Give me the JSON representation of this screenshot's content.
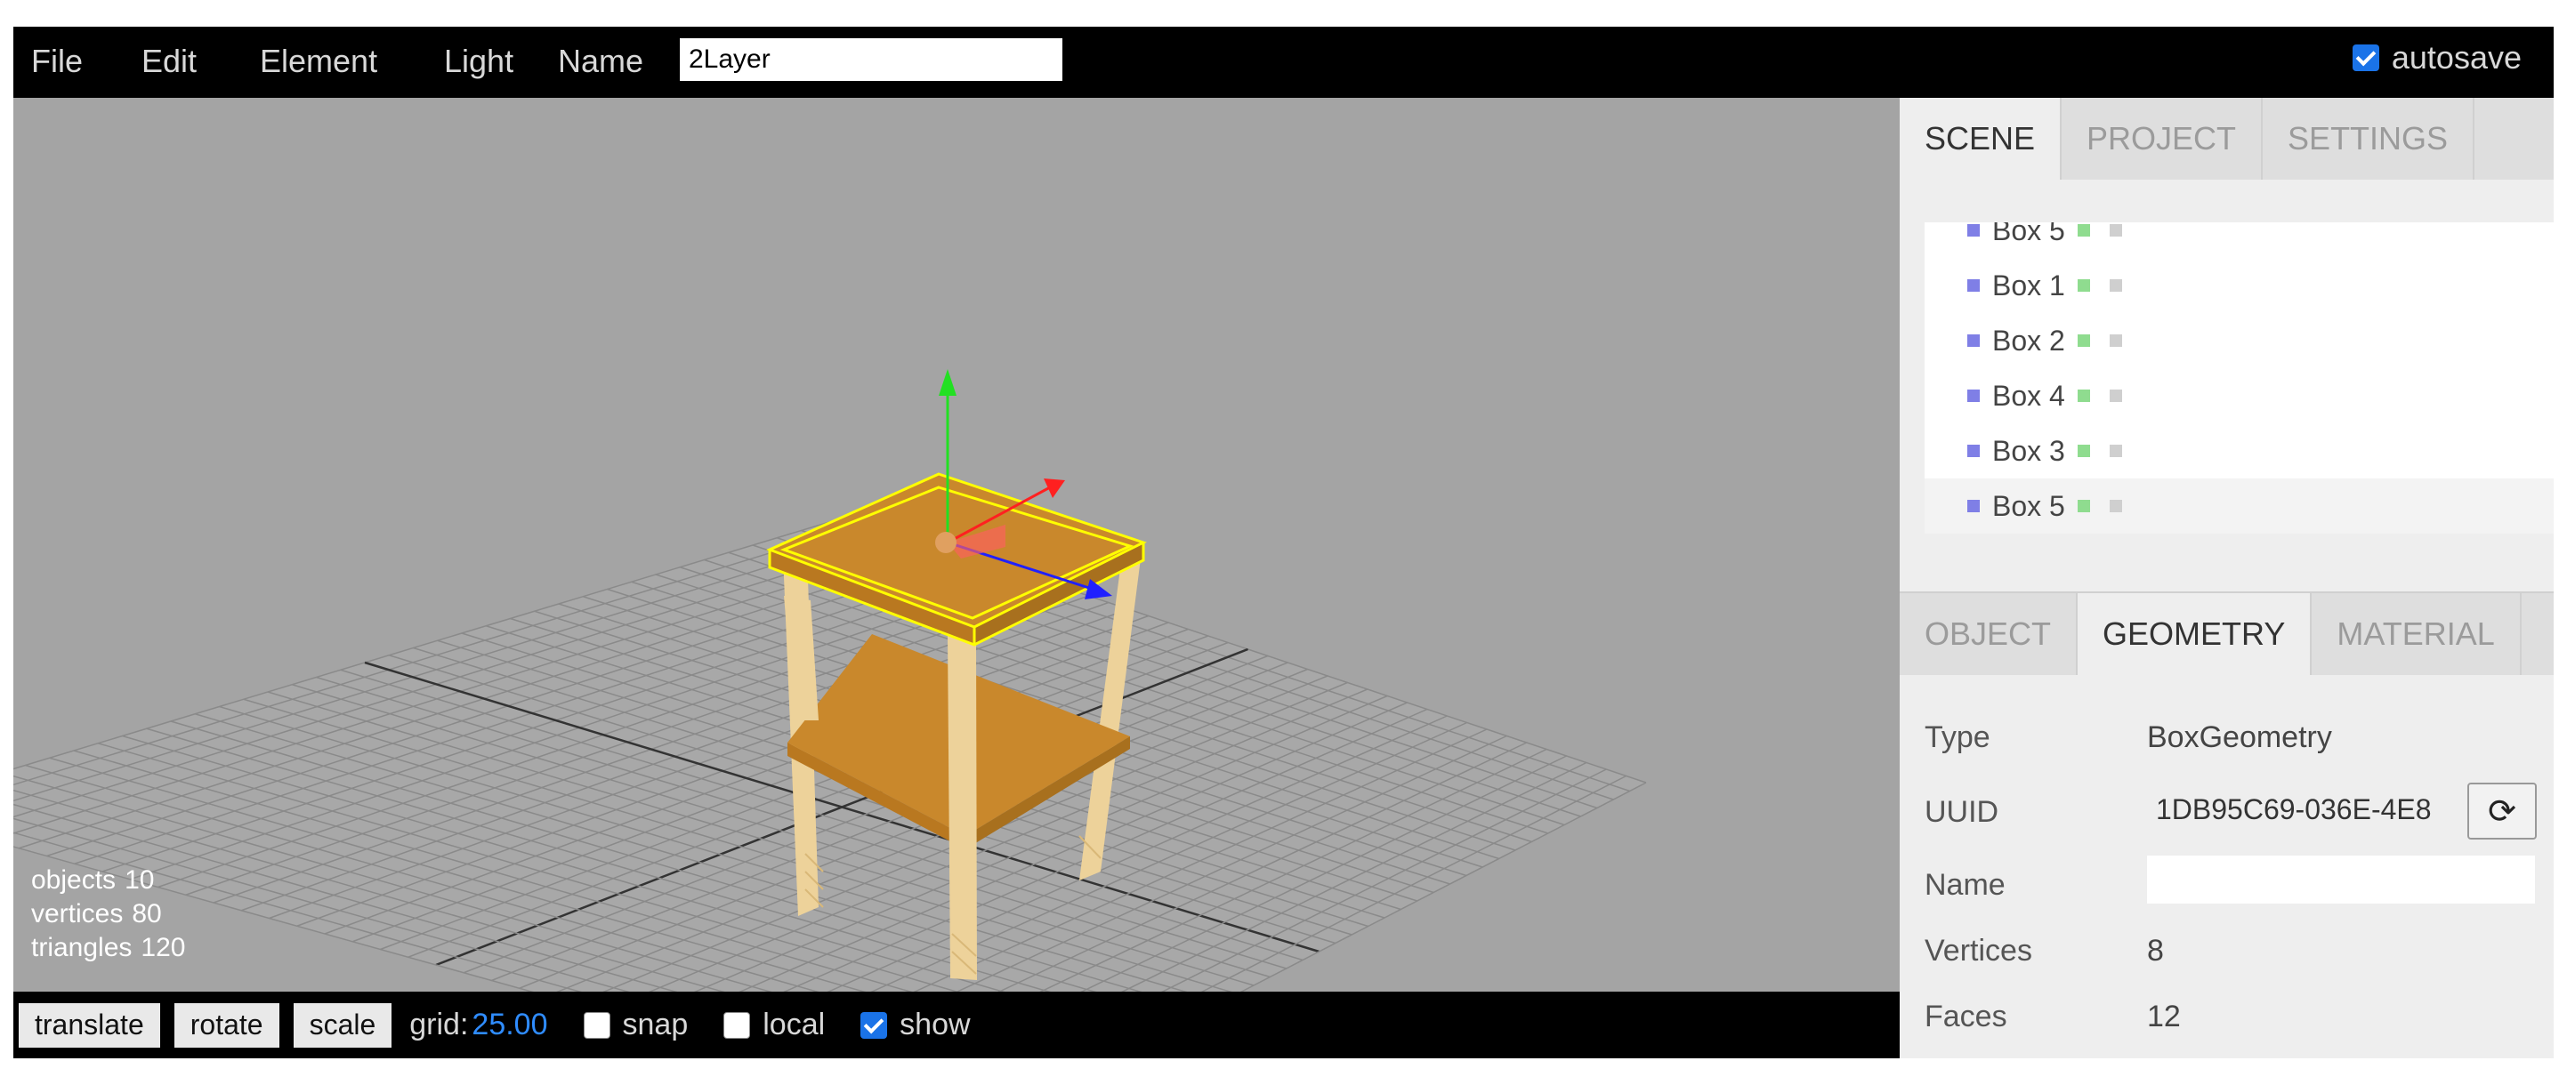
{
  "menu": {
    "items": [
      "File",
      "Edit",
      "Element",
      "Light"
    ],
    "name_label": "Name",
    "name_value": "2Layer",
    "autosave_label": "autosave",
    "autosave_checked": true
  },
  "viewport": {
    "info": {
      "objects_label": "objects",
      "objects_value": "10",
      "vertices_label": "vertices",
      "vertices_value": "80",
      "triangles_label": "triangles",
      "triangles_value": "120"
    }
  },
  "toolbar": {
    "translate_label": "translate",
    "rotate_label": "rotate",
    "scale_label": "scale",
    "grid_label": "grid:",
    "grid_value": "25.00",
    "snap_label": "snap",
    "snap_checked": false,
    "local_label": "local",
    "local_checked": false,
    "show_label": "show",
    "show_checked": true
  },
  "sidebar": {
    "top_tabs": [
      "SCENE",
      "PROJECT",
      "SETTINGS"
    ],
    "top_active": "SCENE",
    "outliner": [
      {
        "label": "Box 5",
        "selected": false
      },
      {
        "label": "Box 1",
        "selected": false
      },
      {
        "label": "Box 2",
        "selected": false
      },
      {
        "label": "Box 4",
        "selected": false
      },
      {
        "label": "Box 3",
        "selected": false
      },
      {
        "label": "Box 5",
        "selected": true
      }
    ],
    "bottom_tabs": [
      "OBJECT",
      "GEOMETRY",
      "MATERIAL"
    ],
    "bottom_active": "GEOMETRY",
    "geometry": {
      "type_label": "Type",
      "type_value": "BoxGeometry",
      "uuid_label": "UUID",
      "uuid_value": "1DB95C69-036E-4E8",
      "name_label": "Name",
      "name_value": "",
      "vertices_label": "Vertices",
      "vertices_value": "8",
      "faces_label": "Faces",
      "faces_value": "12"
    }
  },
  "colors": {
    "viewport_bg": "#a4a4a4",
    "grid_value": "#2f8cff",
    "table_wood": "#c9882c",
    "leg_wood": "#edd29a",
    "selection": "#ffff00",
    "axis_x": "#ff2020",
    "axis_y": "#22e022",
    "axis_z": "#2020ff"
  }
}
